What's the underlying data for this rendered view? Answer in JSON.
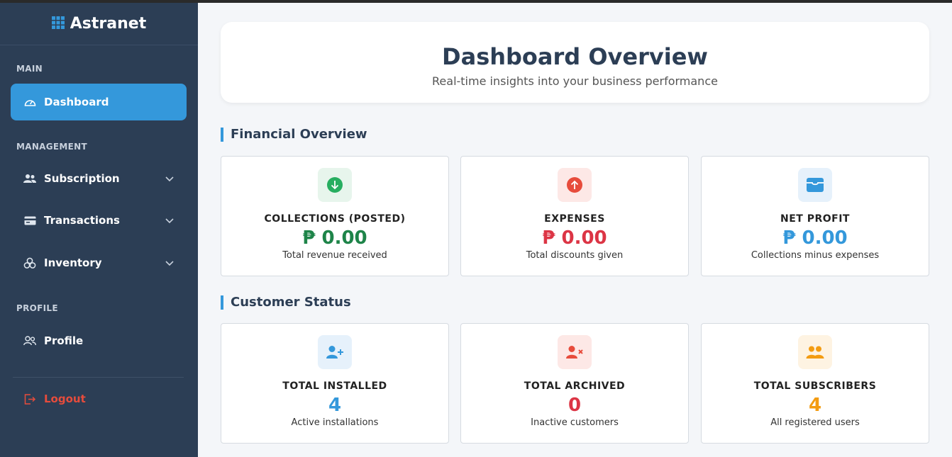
{
  "brand": {
    "name": "Astranet"
  },
  "sidebar": {
    "sections": {
      "main": "MAIN",
      "management": "MANAGEMENT",
      "profile": "PROFILE"
    },
    "items": {
      "dashboard": "Dashboard",
      "subscription": "Subscription",
      "transactions": "Transactions",
      "inventory": "Inventory",
      "profile": "Profile",
      "logout": "Logout"
    }
  },
  "header": {
    "title": "Dashboard Overview",
    "subtitle": "Real-time insights into your business performance"
  },
  "financial": {
    "title": "Financial Overview",
    "cards": [
      {
        "label": "COLLECTIONS (POSTED)",
        "value": "₱ 0.00",
        "desc": "Total revenue received",
        "color": "#1e8449"
      },
      {
        "label": "EXPENSES",
        "value": "₱ 0.00",
        "desc": "Total discounts given",
        "color": "#dc3545"
      },
      {
        "label": "NET PROFIT",
        "value": "₱ 0.00",
        "desc": "Collections minus expenses",
        "color": "#3498db"
      }
    ]
  },
  "customers": {
    "title": "Customer Status",
    "cards": [
      {
        "label": "TOTAL INSTALLED",
        "value": "4",
        "desc": "Active installations",
        "color": "#3498db"
      },
      {
        "label": "TOTAL ARCHIVED",
        "value": "0",
        "desc": "Inactive customers",
        "color": "#dc3545"
      },
      {
        "label": "TOTAL SUBSCRIBERS",
        "value": "4",
        "desc": "All registered users",
        "color": "#f39c12"
      }
    ]
  }
}
